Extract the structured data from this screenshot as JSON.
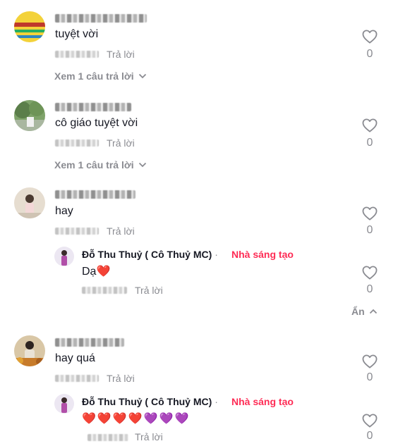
{
  "reply_label": "Trả lời",
  "dots": "...",
  "colors": {
    "text": "#161823",
    "muted": "#8a8b91",
    "creator_badge": "#fe2c55",
    "heart": "#e8222f",
    "purple_heart": "#8c4fd0"
  },
  "comments": [
    {
      "text": "tuyệt vời",
      "likes": "0",
      "view_replies": "Xem 1 câu trả lời"
    },
    {
      "text": "cô giáo tuyệt vời",
      "likes": "0",
      "view_replies": "Xem 1 câu trả lời"
    },
    {
      "text": "hay",
      "likes": "0"
    },
    {
      "text": "hay quá",
      "likes": "0"
    }
  ],
  "replies": [
    {
      "author": "Đỗ Thu Thuỷ ( Cô Thuỷ MC)",
      "separator": "·",
      "badge": "Nhà sáng tạo",
      "text": "Dạ❤️",
      "likes": "0"
    },
    {
      "author": "Đỗ Thu Thuỷ ( Cô Thuỷ MC)",
      "separator": "·",
      "badge": "Nhà sáng tạo",
      "text": "❤️❤️❤️❤️💜💜💜",
      "likes": "0"
    }
  ],
  "hide_label": "Ẩn"
}
